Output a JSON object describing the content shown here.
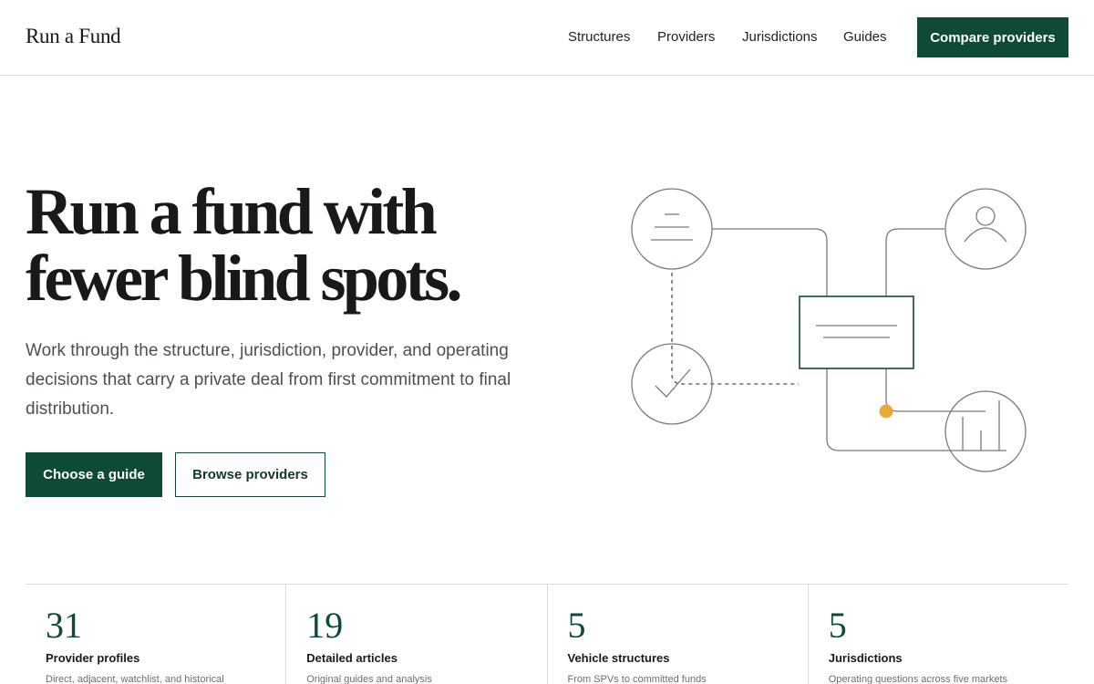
{
  "brand": {
    "name": "Run a Fund"
  },
  "nav": {
    "items": [
      "Structures",
      "Providers",
      "Jurisdictions",
      "Guides"
    ],
    "cta": "Compare providers"
  },
  "hero": {
    "title_lines": [
      "Run a fund with",
      "fewer blind spots."
    ],
    "subtitle": "Work through the structure, jurisdiction, provider, and operating decisions that carry a private deal from first commitment to final distribution.",
    "primary_button": "Choose a guide",
    "secondary_button": "Browse providers"
  },
  "illustration": {
    "icons": [
      "document-icon",
      "user-icon",
      "check-icon",
      "bar-chart-icon",
      "card-icon"
    ],
    "accent_color": "#e9a93a",
    "line_color": "#7a7a7a",
    "brand_color": "#0e4a34"
  },
  "stats": [
    {
      "number": "31",
      "label": "Provider profiles",
      "desc": "Direct, adjacent, watchlist, and historical"
    },
    {
      "number": "19",
      "label": "Detailed articles",
      "desc": "Original guides and analysis"
    },
    {
      "number": "5",
      "label": "Vehicle structures",
      "desc": "From SPVs to committed funds"
    },
    {
      "number": "5",
      "label": "Jurisdictions",
      "desc": "Operating questions across five markets"
    }
  ]
}
